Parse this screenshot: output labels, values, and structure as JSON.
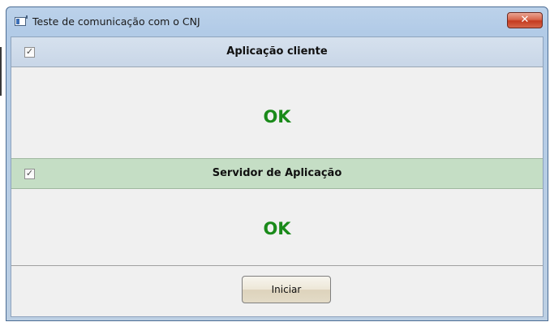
{
  "window": {
    "title": "Teste de comunicação com o CNJ",
    "close_glyph": "✕"
  },
  "sections": [
    {
      "label": "Aplicação cliente",
      "checked": true,
      "check_glyph": "✓",
      "status": "OK",
      "header_color": "#c8d6e7"
    },
    {
      "label": "Servidor de Aplicação",
      "checked": true,
      "check_glyph": "✓",
      "status": "OK",
      "header_color": "#c5dec5"
    }
  ],
  "status_color": "#1a8a1a",
  "buttons": {
    "start_label": "Iniciar"
  },
  "icons": {
    "app": "window-app-icon",
    "close": "close-icon",
    "check": "checkbox-check-icon"
  }
}
